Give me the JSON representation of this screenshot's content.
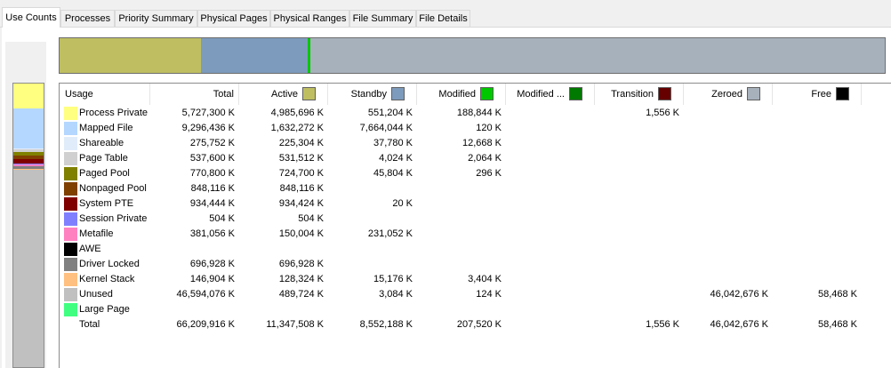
{
  "tabs": [
    {
      "label": "Use Counts",
      "active": true
    },
    {
      "label": "Processes"
    },
    {
      "label": "Priority Summary"
    },
    {
      "label": "Physical Pages"
    },
    {
      "label": "Physical Ranges"
    },
    {
      "label": "File Summary"
    },
    {
      "label": "File Details"
    }
  ],
  "columns": [
    {
      "label": "Usage",
      "align": "left"
    },
    {
      "label": "Total",
      "align": "right"
    },
    {
      "label": "Active",
      "swatch": "#bfbf62"
    },
    {
      "label": "Standby",
      "swatch": "#7d9bbc"
    },
    {
      "label": "Modified",
      "swatch": "#00c800"
    },
    {
      "label": "Modified ...",
      "swatch": "#007a00"
    },
    {
      "label": "Transition",
      "swatch": "#660000"
    },
    {
      "label": "Zeroed",
      "swatch": "#a7b1bc"
    },
    {
      "label": "Free",
      "swatch": "#000000"
    }
  ],
  "usage_bar": {
    "total_k": 66209916,
    "segments": [
      {
        "name": "Active",
        "color": "#bfbf62",
        "value_k": 11347508
      },
      {
        "name": "Standby",
        "color": "#7d9bbc",
        "value_k": 8552188
      },
      {
        "name": "Modified",
        "color": "#00c800",
        "value_k": 207520
      },
      {
        "name": "Zeroed",
        "color": "#a7b1bc",
        "value_k": 46042676
      }
    ]
  },
  "rows": [
    {
      "name": "Process Private",
      "color": "#ffff80",
      "total": "5,727,300 K",
      "active": "4,985,696 K",
      "standby": "551,204 K",
      "modified": "188,844 K",
      "modified_nw": "",
      "transition": "1,556 K",
      "zeroed": "",
      "free": ""
    },
    {
      "name": "Mapped File",
      "color": "#b4d7ff",
      "total": "9,296,436 K",
      "active": "1,632,272 K",
      "standby": "7,664,044 K",
      "modified": "120 K",
      "modified_nw": "",
      "transition": "",
      "zeroed": "",
      "free": ""
    },
    {
      "name": "Shareable",
      "color": "#e1ecfa",
      "total": "275,752 K",
      "active": "225,304 K",
      "standby": "37,780 K",
      "modified": "12,668 K",
      "modified_nw": "",
      "transition": "",
      "zeroed": "",
      "free": ""
    },
    {
      "name": "Page Table",
      "color": "#d0d0d0",
      "total": "537,600 K",
      "active": "531,512 K",
      "standby": "4,024 K",
      "modified": "2,064 K",
      "modified_nw": "",
      "transition": "",
      "zeroed": "",
      "free": ""
    },
    {
      "name": "Paged Pool",
      "color": "#808000",
      "total": "770,800 K",
      "active": "724,700 K",
      "standby": "45,804 K",
      "modified": "296 K",
      "modified_nw": "",
      "transition": "",
      "zeroed": "",
      "free": ""
    },
    {
      "name": "Nonpaged Pool",
      "color": "#804000",
      "total": "848,116 K",
      "active": "848,116 K",
      "standby": "",
      "modified": "",
      "modified_nw": "",
      "transition": "",
      "zeroed": "",
      "free": ""
    },
    {
      "name": "System PTE",
      "color": "#800000",
      "total": "934,444 K",
      "active": "934,424 K",
      "standby": "20 K",
      "modified": "",
      "modified_nw": "",
      "transition": "",
      "zeroed": "",
      "free": ""
    },
    {
      "name": "Session Private",
      "color": "#8080ff",
      "total": "504 K",
      "active": "504 K",
      "standby": "",
      "modified": "",
      "modified_nw": "",
      "transition": "",
      "zeroed": "",
      "free": ""
    },
    {
      "name": "Metafile",
      "color": "#ff80c0",
      "total": "381,056 K",
      "active": "150,004 K",
      "standby": "231,052 K",
      "modified": "",
      "modified_nw": "",
      "transition": "",
      "zeroed": "",
      "free": ""
    },
    {
      "name": "AWE",
      "color": "#000000",
      "total": "",
      "active": "",
      "standby": "",
      "modified": "",
      "modified_nw": "",
      "transition": "",
      "zeroed": "",
      "free": ""
    },
    {
      "name": "Driver Locked",
      "color": "#808080",
      "total": "696,928 K",
      "active": "696,928 K",
      "standby": "",
      "modified": "",
      "modified_nw": "",
      "transition": "",
      "zeroed": "",
      "free": ""
    },
    {
      "name": "Kernel Stack",
      "color": "#ffc080",
      "total": "146,904 K",
      "active": "128,324 K",
      "standby": "15,176 K",
      "modified": "3,404 K",
      "modified_nw": "",
      "transition": "",
      "zeroed": "",
      "free": ""
    },
    {
      "name": "Unused",
      "color": "#c0c0c0",
      "total": "46,594,076 K",
      "active": "489,724 K",
      "standby": "3,084 K",
      "modified": "124 K",
      "modified_nw": "",
      "transition": "",
      "zeroed": "46,042,676 K",
      "free": "58,468 K"
    },
    {
      "name": "Large Page",
      "color": "#40ff80",
      "total": "",
      "active": "",
      "standby": "",
      "modified": "",
      "modified_nw": "",
      "transition": "",
      "zeroed": "",
      "free": ""
    },
    {
      "name": "Total",
      "color": "",
      "total": "66,209,916 K",
      "active": "11,347,508 K",
      "standby": "8,552,188 K",
      "modified": "207,520 K",
      "modified_nw": "",
      "transition": "1,556 K",
      "zeroed": "46,042,676 K",
      "free": "58,468 K"
    }
  ]
}
